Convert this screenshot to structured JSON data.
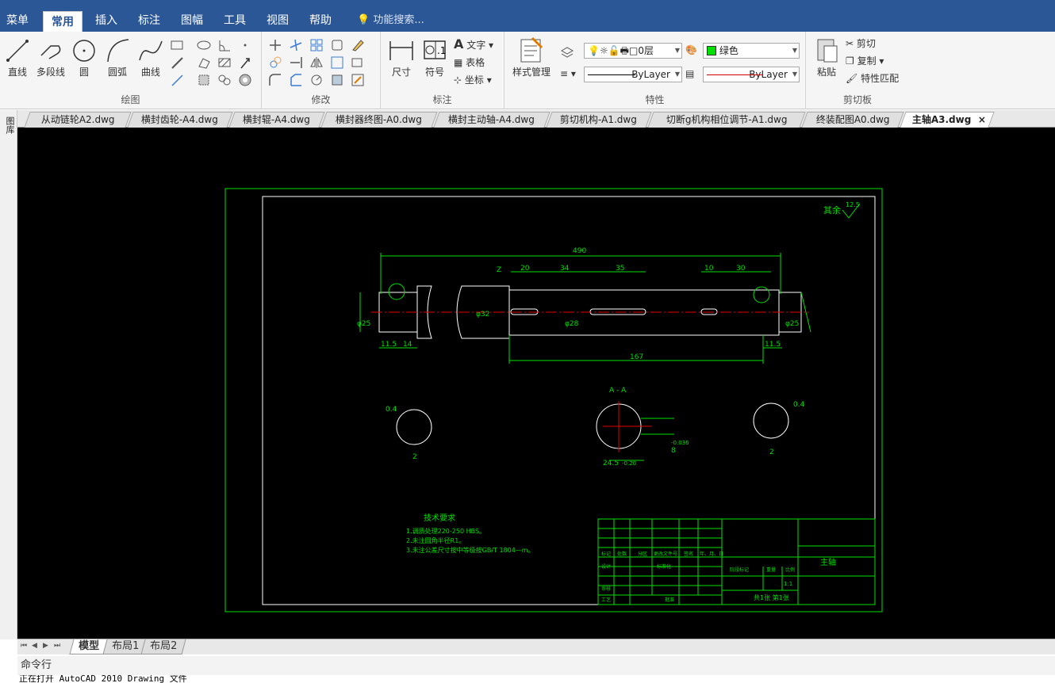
{
  "menubar": {
    "items": [
      "菜单",
      "常用",
      "插入",
      "标注",
      "图幅",
      "工具",
      "视图",
      "帮助"
    ],
    "active": "常用",
    "search_placeholder": "功能搜索..."
  },
  "ribbon": {
    "draw": {
      "title": "绘图",
      "line": "直线",
      "polyline": "多段线",
      "circle": "圆",
      "arc": "圆弧",
      "curve": "曲线"
    },
    "modify": {
      "title": "修改"
    },
    "annotate": {
      "title": "标注",
      "dimension": "尺寸",
      "symbol": "符号",
      "text": "文字",
      "table": "表格",
      "coordinate": "坐标"
    },
    "properties": {
      "title": "特性",
      "style_mgr": "样式管理",
      "layer": "0层",
      "color": "绿色",
      "linetype": "ByLayer",
      "lineweight": "ByLayer"
    },
    "clipboard": {
      "title": "剪切板",
      "paste": "粘贴",
      "cut": "剪切",
      "copy": "复制",
      "match": "特性匹配"
    }
  },
  "tabs": [
    "从动链轮A2.dwg",
    "横封齿轮-A4.dwg",
    "横封辊-A4.dwg",
    "横封器终图-A0.dwg",
    "横封主动轴-A4.dwg",
    "剪切机构-A1.dwg",
    "切断g机构相位调节-A1.dwg",
    "终装配图A0.dwg",
    "主轴A3.dwg"
  ],
  "active_tab": "主轴A3.dwg",
  "tab_close": "×",
  "left_strip_label": "图库",
  "drawing": {
    "roughness": "其余",
    "roughness_val": "12.5",
    "dims": {
      "total": "490",
      "d1": "20",
      "d2": "34",
      "d3": "35",
      "d4": "10",
      "d5": "30",
      "d6": "167",
      "d7": "11.5",
      "d8": "14",
      "d9": "11.5",
      "z": "Z",
      "phi1": "φ25",
      "phi2": "φ32",
      "phi3": "φ28",
      "phi4": "φ25",
      "sec": "A - A",
      "sec_w": "24.5",
      "sec_tol": "-0.20",
      "sec_d": "8",
      "sec_tol2": "-0.036",
      "tol_a": "0.4",
      "tol_b": "0.4",
      "two_a": "2",
      "two_b": "2"
    },
    "tech_title": "技术要求",
    "tech_items": [
      "1.调质处理220-250 HBS。",
      "2.未注圆角半径R1。",
      "3.未注公差尺寸按中等级按GB/T 1804—m。"
    ],
    "title_block": {
      "part_name": "主轴",
      "scale": "1:1",
      "sheet": "共1张 第1张",
      "labels": [
        "标记",
        "处数",
        "分区",
        "更改文件号",
        "签名",
        "年、月、日",
        "设计",
        "标准化",
        "阶段标记",
        "重量",
        "比例",
        "审核",
        "工艺",
        "批准"
      ]
    }
  },
  "layout_tabs": [
    "模型",
    "布局1",
    "布局2"
  ],
  "active_layout": "模型",
  "nav": [
    "⏮",
    "◀",
    "▶",
    "⏭"
  ],
  "cmd": {
    "header": "命令行",
    "line": "正在打开 AutoCAD 2010 Drawing 文件"
  }
}
